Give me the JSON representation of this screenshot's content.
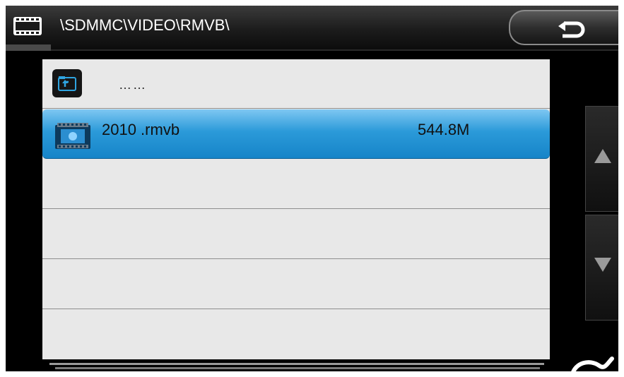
{
  "header": {
    "path": "\\SDMMC\\VIDEO\\RMVB\\",
    "icon": "film-strip-icon",
    "back_icon": "back-arrow-icon"
  },
  "list": {
    "parent_row": {
      "icon": "folder-up-icon",
      "label": "……"
    },
    "files": [
      {
        "name": "2010 .rmvb",
        "size": "544.8M",
        "icon": "video-file-icon",
        "selected": true
      }
    ],
    "empty_rows": 3
  },
  "scroll": {
    "up_icon": "triangle-up-icon",
    "down_icon": "triangle-down-icon"
  },
  "colors": {
    "selection": "#2b9ad9",
    "list_background": "#e8e8e8",
    "header": "#1c1c1c"
  }
}
